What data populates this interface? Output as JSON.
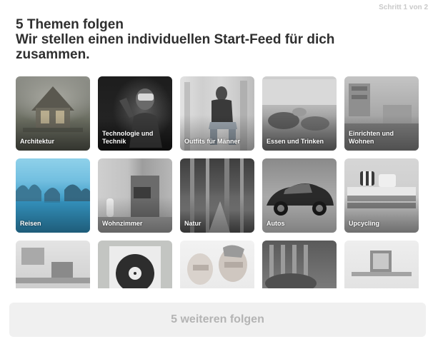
{
  "header": {
    "step": "Schritt 1 von 2",
    "title_line1": "5 Themen folgen",
    "title_line2": "Wir stellen einen individuellen Start-Feed für dich",
    "title_line3": "zusammen."
  },
  "topics": [
    {
      "label": "Architektur"
    },
    {
      "label": "Technologie und Technik"
    },
    {
      "label": "Outfits für Männer"
    },
    {
      "label": "Essen und Trinken"
    },
    {
      "label": "Einrichten und Wohnen"
    },
    {
      "label": "Reisen"
    },
    {
      "label": "Wohnzimmer"
    },
    {
      "label": "Natur"
    },
    {
      "label": "Autos"
    },
    {
      "label": "Upcycling"
    },
    {
      "label": ""
    },
    {
      "label": ""
    },
    {
      "label": ""
    },
    {
      "label": ""
    },
    {
      "label": ""
    }
  ],
  "footer": {
    "follow_button": "5 weiteren folgen"
  }
}
